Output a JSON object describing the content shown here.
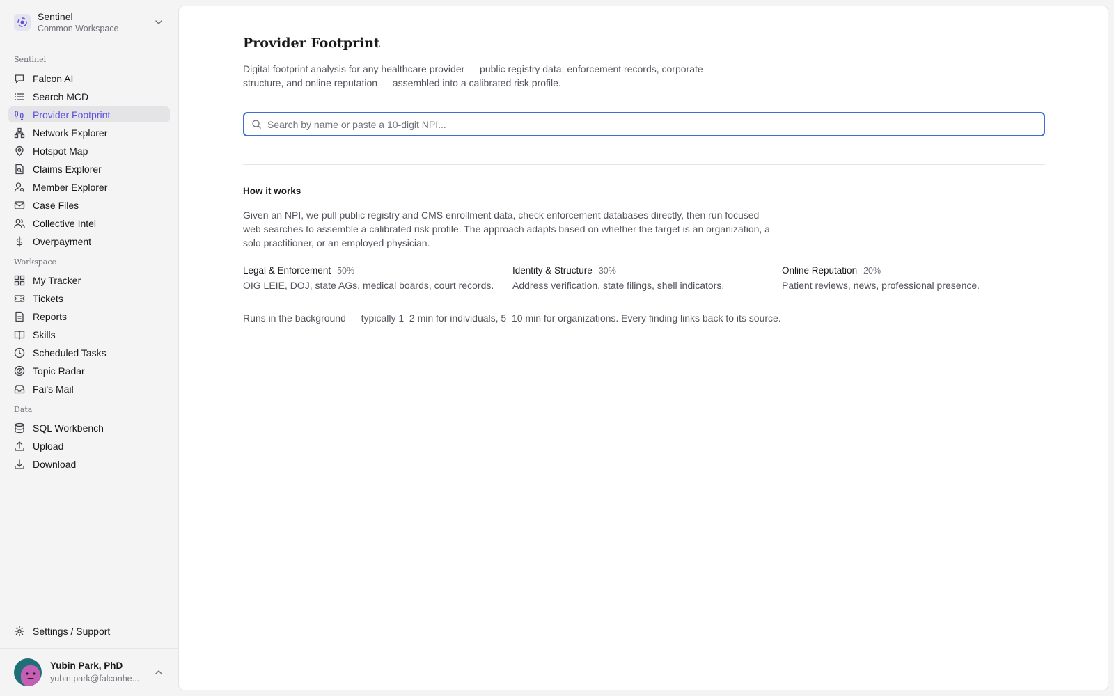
{
  "workspace": {
    "name": "Sentinel",
    "subtitle": "Common Workspace"
  },
  "sidebar": {
    "sections": [
      {
        "label": "Sentinel"
      },
      {
        "label": "Workspace"
      },
      {
        "label": "Data"
      }
    ],
    "items": [
      {
        "label": "Falcon AI",
        "icon": "chat-icon"
      },
      {
        "label": "Search MCD",
        "icon": "list-icon"
      },
      {
        "label": "Provider Footprint",
        "icon": "footprint-icon",
        "active": true
      },
      {
        "label": "Network Explorer",
        "icon": "network-icon"
      },
      {
        "label": "Hotspot Map",
        "icon": "map-pin-icon"
      },
      {
        "label": "Claims Explorer",
        "icon": "file-search-icon"
      },
      {
        "label": "Member Explorer",
        "icon": "user-search-icon"
      },
      {
        "label": "Case Files",
        "icon": "mail-icon"
      },
      {
        "label": "Collective Intel",
        "icon": "users-icon"
      },
      {
        "label": "Overpayment",
        "icon": "dollar-icon"
      },
      {
        "label": "My Tracker",
        "icon": "grid-icon"
      },
      {
        "label": "Tickets",
        "icon": "ticket-icon"
      },
      {
        "label": "Reports",
        "icon": "document-icon"
      },
      {
        "label": "Skills",
        "icon": "book-icon"
      },
      {
        "label": "Scheduled Tasks",
        "icon": "clock-icon"
      },
      {
        "label": "Topic Radar",
        "icon": "radar-icon"
      },
      {
        "label": "Fai's Mail",
        "icon": "inbox-icon"
      },
      {
        "label": "SQL Workbench",
        "icon": "database-icon"
      },
      {
        "label": "Upload",
        "icon": "upload-icon"
      },
      {
        "label": "Download",
        "icon": "download-icon"
      }
    ],
    "settings_label": "Settings / Support"
  },
  "user": {
    "name": "Yubin Park, PhD",
    "email": "yubin.park@falconhe..."
  },
  "main": {
    "title": "Provider Footprint",
    "description": "Digital footprint analysis for any healthcare provider — public registry data, enforcement records, corporate structure, and online reputation — assembled into a calibrated risk profile.",
    "search_placeholder": "Search by name or paste a 10-digit NPI...",
    "how_title": "How it works",
    "how_body": "Given an NPI, we pull public registry and CMS enrollment data, check enforcement databases directly, then run focused web searches to assemble a calibrated risk profile. The approach adapts based on whether the target is an organization, a solo practitioner, or an employed physician.",
    "pillars": [
      {
        "title": "Legal & Enforcement",
        "weight": "50%",
        "desc": "OIG LEIE, DOJ, state AGs, medical boards, court records."
      },
      {
        "title": "Identity & Structure",
        "weight": "30%",
        "desc": "Address verification, state filings, shell indicators."
      },
      {
        "title": "Online Reputation",
        "weight": "20%",
        "desc": "Patient reviews, news, professional presence."
      }
    ],
    "footnote": "Runs in the background — typically 1–2 min for individuals, 5–10 min for organizations. Every finding links back to its source."
  },
  "colors": {
    "accent": "#5b4fe0",
    "focus_border": "#3b6fd4",
    "sidebar_bg": "#f4f4f5"
  }
}
